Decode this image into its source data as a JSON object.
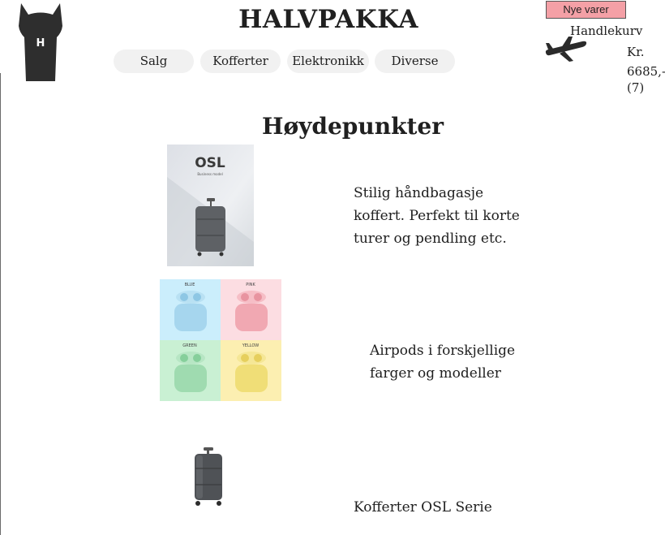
{
  "header": {
    "site_title": "HALVPAKKA",
    "logo_letter": "H",
    "nav": [
      "Salg",
      "Kofferter",
      "Elektronikk",
      "Diverse"
    ],
    "new_items_button": "Nye varer",
    "cart": {
      "label": "Handlekurv",
      "currency": "Kr.",
      "amount": "6685,-",
      "count": "(7)"
    }
  },
  "main": {
    "heading": "Høydepunkter",
    "products": [
      {
        "image_brand": "OSL",
        "image_caption": "Business model",
        "description": [
          "Stilig håndbagasje",
          "koffert. Perfekt til korte",
          "turer og pendling etc."
        ]
      },
      {
        "image_colors": [
          "BLUE",
          "PINK",
          "GREEN",
          "YELLOW"
        ],
        "description": [
          "Airpods i forskjellige",
          "farger og modeller"
        ]
      },
      {
        "description": [
          "Kofferter OSL Serie"
        ]
      }
    ]
  },
  "colors": {
    "new_items_bg": "#f4a0a6",
    "logo": "#2e2e2e",
    "nav_pill_bg": "#f1f1f1"
  },
  "icons": [
    "logo-icon",
    "airplane-icon"
  ]
}
